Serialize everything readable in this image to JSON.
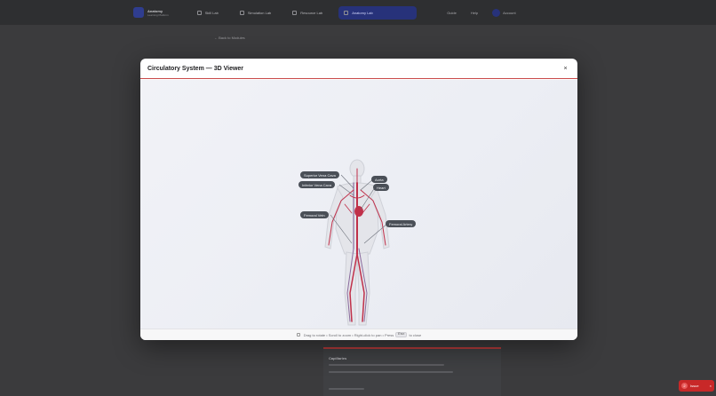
{
  "app": {
    "brand_title": "Anatomy",
    "brand_subtitle": "Learning Platform",
    "nav": [
      {
        "label": "Skill Lab"
      },
      {
        "label": "Simulation Lab"
      },
      {
        "label": "Resource Lab"
      },
      {
        "label": "Anatomy Lab"
      }
    ],
    "right_nav": [
      {
        "label": "Guide"
      },
      {
        "label": "Help"
      },
      {
        "label": "Account"
      }
    ],
    "back_link": "← Back to Modules",
    "bg_card_title": "Capillaries",
    "toast_count": "2",
    "toast_text": "Issue",
    "toast_close": "×"
  },
  "modal": {
    "title": "Circulatory System — 3D Viewer",
    "close": "×",
    "labels": {
      "superior_vena_cava": "Superior Vena Cava",
      "inferior_vena_cava": "Inferior Vena Cava",
      "aorta": "Aorta",
      "heart": "Heart",
      "femoral_vein": "Femoral Vein",
      "femoral_artery": "Femoral Artery"
    },
    "footer": {
      "hint": "Drag to rotate • Scroll to zoom • Right-click to pan • Press",
      "key": "Esc",
      "suffix": "to close"
    }
  },
  "colors": {
    "accent": "#27327a",
    "artery": "#c0304a",
    "vein": "#8a6b9e",
    "close_divider": "#c94a4a",
    "toast": "#c82828"
  }
}
